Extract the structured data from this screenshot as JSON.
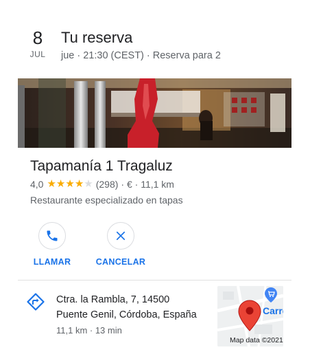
{
  "reservation": {
    "day": "8",
    "month": "JUL",
    "title": "Tu reserva",
    "details": "jue · 21:30 (CEST) · Reserva para 2"
  },
  "place": {
    "name": "Tapamanía 1 Tragaluz",
    "rating": "4,0",
    "rating_value": 4,
    "rating_max": 5,
    "reviews": "(298)",
    "price_distance": "· € · 11,1 km",
    "category": "Restaurante especializado en tapas"
  },
  "actions": {
    "call": "LLAMAR",
    "cancel": "CANCELAR"
  },
  "address": {
    "line1": "Ctra. la Rambla, 7, 14500",
    "line2": "Puente Genil, Córdoba, España",
    "travel": "11,1 km · 13 min"
  },
  "map": {
    "attribution": "Map data ©2021",
    "store_label": "Carrefour"
  },
  "colors": {
    "accent": "#1a73e8",
    "star": "#f9ab00",
    "pin": "#ea4335"
  },
  "icons": {
    "call": "phone-icon",
    "cancel": "close-icon",
    "directions": "directions-icon",
    "pin": "map-pin-icon"
  }
}
